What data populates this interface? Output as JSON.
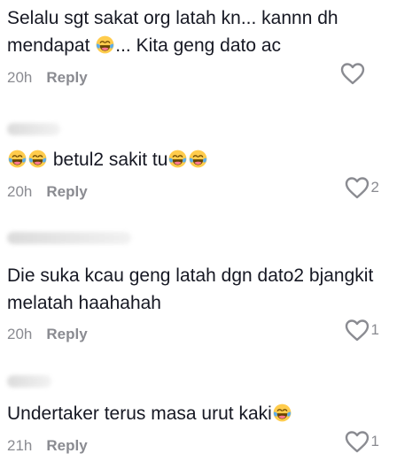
{
  "comments": [
    {
      "text_line1_a": "Selalu sgt sakat org latah kn... kannn dh",
      "text_line2_a": "mendapat ",
      "text_line2_b": "... Kita geng dato ac",
      "time": "20h",
      "reply": "Reply",
      "likes": ""
    },
    {
      "text_a": " betul2 sakit tu",
      "time": "20h",
      "reply": "Reply",
      "likes": "2"
    },
    {
      "text_line1": "Die suka kcau geng latah dgn dato2 bjangkit",
      "text_line2": "melatah haahahah",
      "time": "20h",
      "reply": "Reply",
      "likes": "1"
    },
    {
      "text_a": "Undertaker terus masa urut kaki",
      "time": "21h",
      "reply": "Reply",
      "likes": "1"
    }
  ],
  "icons": {
    "like": "heart-outline-icon",
    "emoji": "face-with-tears-of-joy-emoji"
  },
  "colors": {
    "text": "#161823",
    "muted": "#8a8b91"
  }
}
